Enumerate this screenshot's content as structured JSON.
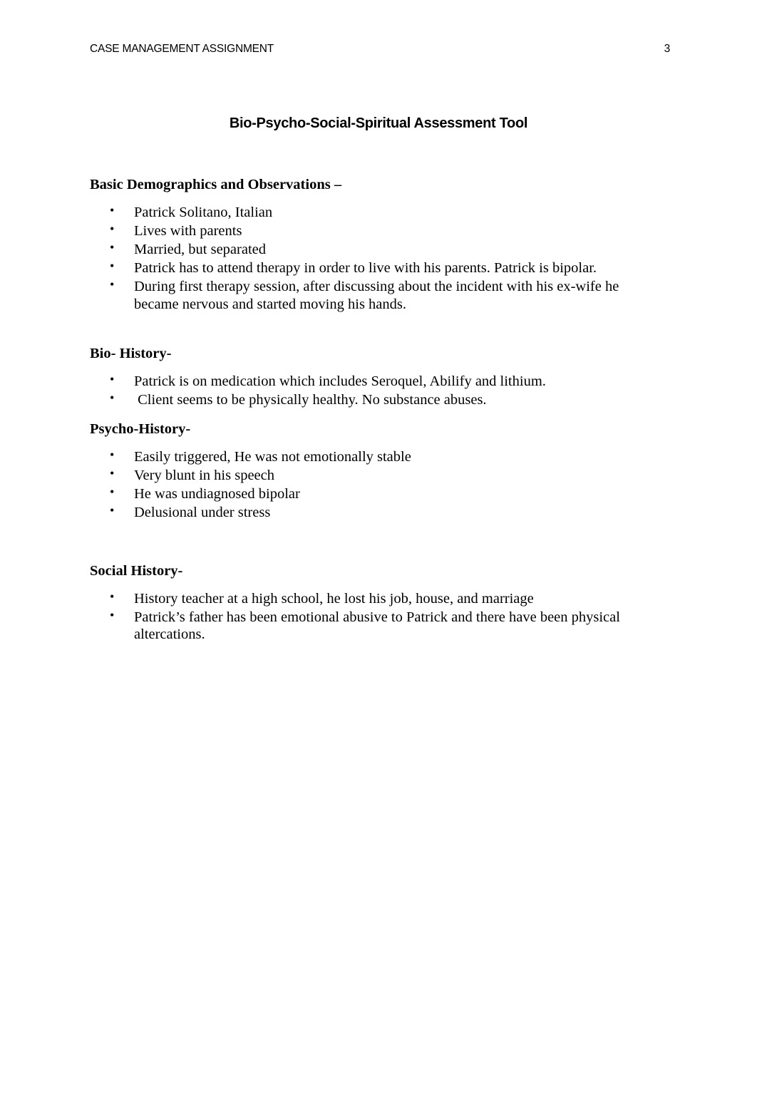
{
  "header": {
    "running_title": "CASE MANAGEMENT ASSIGNMENT",
    "page_number": "3"
  },
  "document": {
    "title": "Bio-Psycho-Social-Spiritual Assessment Tool"
  },
  "sections": [
    {
      "heading": "Basic Demographics and Observations –",
      "items": [
        "Patrick Solitano, Italian",
        "Lives with parents",
        "Married, but separated",
        "Patrick has to attend therapy in order to live with his parents. Patrick is bipolar.",
        "During first therapy session, after discussing about the incident with his ex-wife he became nervous and started moving his hands."
      ]
    },
    {
      "heading": "Bio- History-",
      "items": [
        "Patrick is on medication which includes Seroquel, Abilify and lithium.",
        " Client seems to be physically healthy. No substance abuses."
      ]
    },
    {
      "heading": "Psycho-History-",
      "items": [
        "Easily triggered, He was not emotionally stable",
        "Very blunt in his speech",
        "He was undiagnosed bipolar",
        "Delusional under stress"
      ]
    },
    {
      "heading": "Social History-",
      "items": [
        "History teacher at a high school, he lost his job, house, and marriage",
        "Patrick’s father has been emotional abusive to Patrick and there have been physical altercations."
      ]
    }
  ],
  "bullet_glyph": "•"
}
